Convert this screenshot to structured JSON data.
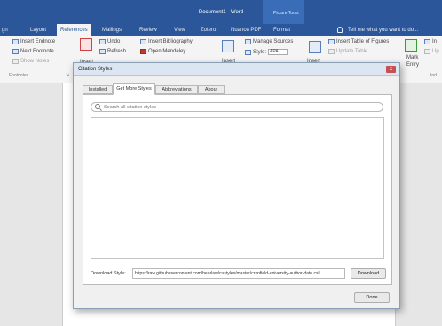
{
  "window": {
    "title": "Document1 - Word",
    "tools_label": "Picture Tools"
  },
  "tabs": [
    {
      "label": "gn"
    },
    {
      "label": "Layout"
    },
    {
      "label": "References"
    },
    {
      "label": "Mailings"
    },
    {
      "label": "Review"
    },
    {
      "label": "View"
    },
    {
      "label": "Zotero"
    },
    {
      "label": "Nuance PDF"
    },
    {
      "label": "Format"
    }
  ],
  "tell_me": "Tell me what you want to do...",
  "ribbon": {
    "insert_endnote": "Insert Endnote",
    "next_footnote": "Next Footnote",
    "show_notes": "Show Notes",
    "footnotes_group": "Footnotes",
    "insert_short": "Insert",
    "undo": "Undo",
    "refresh": "Refresh",
    "insert_bibliography": "Insert Bibliography",
    "open_mendeley": "Open Mendeley",
    "insert_citation": "Insert",
    "manage_sources": "Manage Sources",
    "style_label": "Style:",
    "style_value": "APA",
    "insert_caption": "Insert",
    "insert_table_of_figures": "Insert Table of Figures",
    "update_table": "Update Table",
    "mark_entry_1": "Mark",
    "mark_entry_2": "Entry",
    "ind": "Ind",
    "ins_right": "In",
    "up_right": "Up"
  },
  "dialog": {
    "title": "Citation Styles",
    "close": "x",
    "tabs": [
      "Installed",
      "Get More Styles",
      "Abbreviations",
      "About"
    ],
    "search_placeholder": "Search all citation styles",
    "download_label": "Download Style:",
    "download_url": "https://raw.githubusercontent.com/bearlaw/custyles/master/cranfield-university-author-date.csl",
    "download_button": "Download",
    "done_button": "Done"
  },
  "colors": {
    "accent": "#2b579a",
    "close": "#c75050"
  }
}
